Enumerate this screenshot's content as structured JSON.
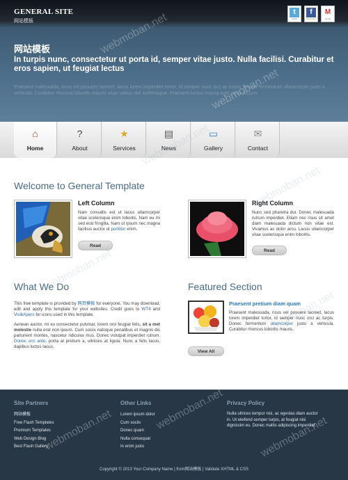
{
  "site": {
    "name": "GENERAL SITE",
    "tagline": "网站模板"
  },
  "social": [
    {
      "name": "twitter",
      "icon": "twitter-icon",
      "label": "Twitter",
      "color": "#5aa9d6",
      "glyph": "t"
    },
    {
      "name": "facebook",
      "icon": "facebook-icon",
      "label": "Facebook",
      "color": "#3b5998",
      "glyph": "f"
    },
    {
      "name": "gmail",
      "icon": "gmail-icon",
      "label": "Gmail",
      "color": "#d33",
      "glyph": "M"
    }
  ],
  "hero": {
    "title": "网站模板",
    "subtitle": "In turpis nunc, consectetur ut porta id, semper vitae justo. Nulla facilisi. Curabitur et eros sapien, ut feugiat lectus",
    "body": "Praesent malesuada, risus vel posuere laoreet, lacus lorem imperdiet tortor, id semper nunc orci ac turpis. Donec fermentum ullamcorper justo a vehicula. Curabitur rhoncus lobortis mauris vitae varius nisl scelerisque. Praesent luctus massa eget risus dictum."
  },
  "nav": [
    {
      "label": "Home",
      "icon": "home-icon",
      "glyph": "⌂",
      "color": "#b5342a",
      "active": true
    },
    {
      "label": "About",
      "icon": "speech-bubble-question-icon",
      "glyph": "?",
      "color": "#444"
    },
    {
      "label": "Services",
      "icon": "star-icon",
      "glyph": "★",
      "color": "#e0a820"
    },
    {
      "label": "News",
      "icon": "newspaper-icon",
      "glyph": "▤",
      "color": "#555"
    },
    {
      "label": "Gallery",
      "icon": "monitor-icon",
      "glyph": "▭",
      "color": "#3a7fc0"
    },
    {
      "label": "Contact",
      "icon": "envelope-icon",
      "glyph": "✉",
      "color": "#888"
    }
  ],
  "welcome": {
    "heading": "Welcome to General Template",
    "left": {
      "title": "Left Column",
      "text": "Nam convallis est ut lacus ullamcorper vitae scelerisque enim lobortis. Nam eu mi sed erat fringilla. Nam ut ipsum nec magna facilisis auctor ut",
      "link": "porttitor",
      "after": "enim.",
      "button": "Read"
    },
    "right": {
      "title": "Right Column",
      "text": "Nunc sed pharetra dui. Donec malesuada rutrum imperdiet. Etiam nec risus sit amet diam malesuada dictum non vitae est. Vivamus ac dolor arcu. Lacus ullamcorper vitae scelerisque enim lobortis.",
      "button": "Read"
    }
  },
  "whatwedo": {
    "heading": "What We Do",
    "p1_a": "This free template is provided by",
    "p1_link1": "网页模板",
    "p1_b": "for everyone. You may download, edit and apply this template for your websites. Credit goes to",
    "p1_link2": "WT4",
    "p1_c": "and",
    "p1_link3": "VisibApers",
    "p1_d": "for icons used in this template.",
    "p2_a": "Aenean auctor, mi eu consectetur pulvinar, lorem orci feugiat felis,",
    "p2_bold": "sit a met molestie",
    "p2_b": "nulla erat non ipsum. Cum sociis natoque penatibus et magnis dis parturient montes, nascetur ridiculus mus. Donec volutpat imperdiet rutrum.",
    "p2_link": "Donec orci ante",
    "p2_c": ", porta at pretium a, ultricies at ligula. Nunc a felis lacus, dapibus luctus lacus."
  },
  "featured": {
    "heading": "Featured Section",
    "title": "Praesent pretium diam quam",
    "text_a": "Praesent malesuada, risus vel posuere laoreet, lacus lorem imperdiet tortor, id semper nunc orci ac turpis. Donec fermentum",
    "link": "ullamcorper",
    "text_b": "justo a vehicula. Curabitur rhoncus lobortis mauris.",
    "button": "View All"
  },
  "footer": {
    "partners": {
      "heading": "Site Partners",
      "items": [
        "网站模板",
        "Free Flash Templates",
        "Premium Templates",
        "Web Design Blog",
        "Best Flash Gallery"
      ]
    },
    "links": {
      "heading": "Other Links",
      "items": [
        "Lorem ipsum dolor",
        "Cum sociis",
        "Donec quam",
        "Nulla consequat",
        "In enim justo"
      ]
    },
    "privacy": {
      "heading": "Privacy Policy",
      "text": "Nulla ultrices tempor nisi, ac egestas diam auctor in. Ut eleifend semper turpis, at feugiat nisi dignissim eu. Donec mattis adipiscing imperdiet."
    },
    "copyright": "Copyright © 2013 Your Company Name | from网站模板 | Validate XHTML & CSS"
  },
  "watermark": "webmoban.net"
}
